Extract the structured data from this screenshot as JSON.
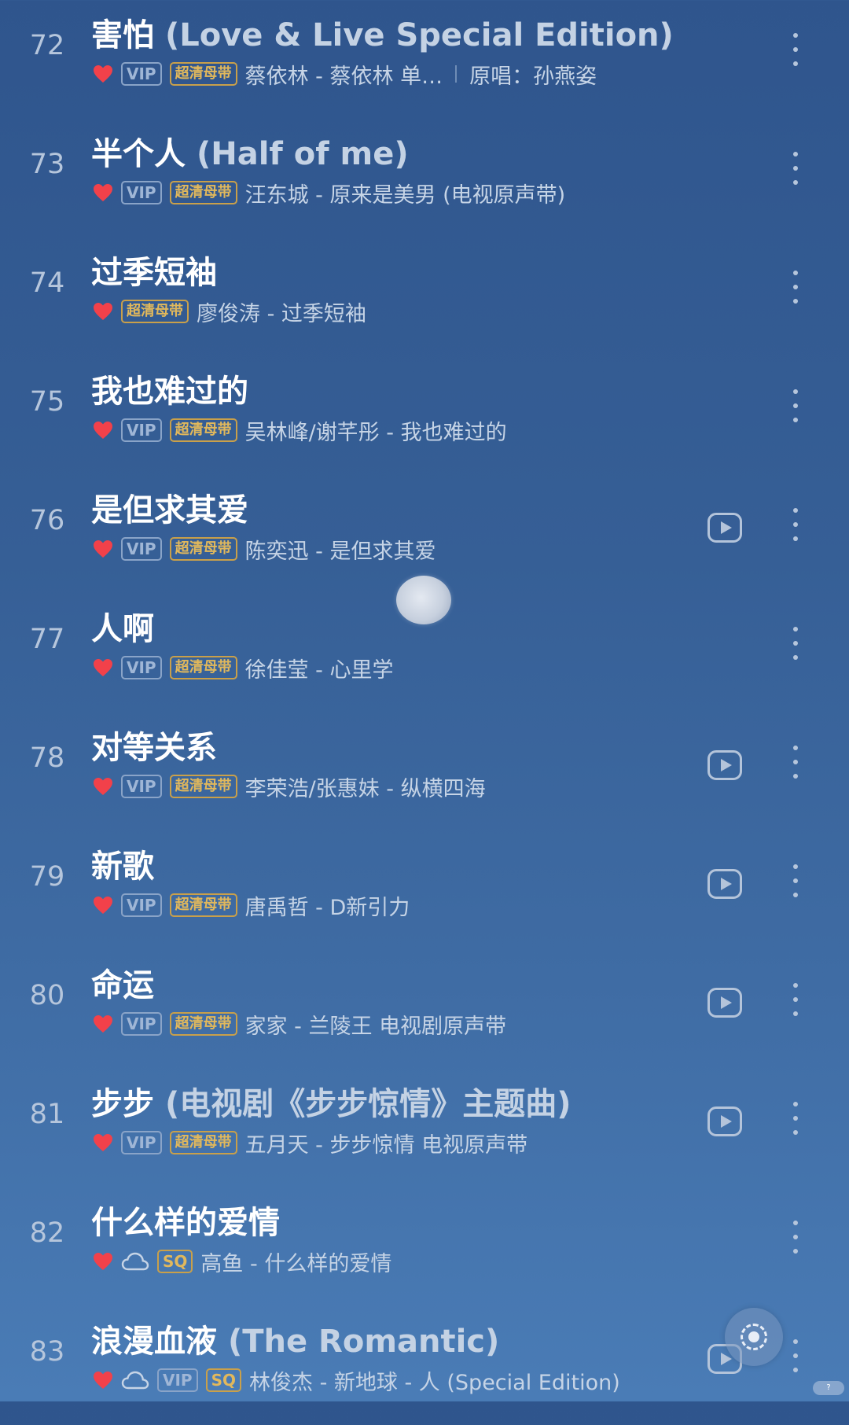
{
  "songs": [
    {
      "num": "72",
      "title": "害怕",
      "subtitle": "(Love & Live Special Edition)",
      "vip": "VIP",
      "quality": "超清母带",
      "info": "蔡依林 - 蔡依林 单…",
      "extra": "原唱：孙燕姿",
      "play": false
    },
    {
      "num": "73",
      "title": "半个人",
      "subtitle": "(Half of me)",
      "vip": "VIP",
      "quality": "超清母带",
      "info": "汪东城 - 原来是美男 (电视原声带)",
      "play": false
    },
    {
      "num": "74",
      "title": "过季短袖",
      "subtitle": "",
      "quality": "超清母带",
      "info": "廖俊涛 - 过季短袖",
      "play": false
    },
    {
      "num": "75",
      "title": "我也难过的",
      "subtitle": "",
      "vip": "VIP",
      "quality": "超清母带",
      "info": "吴林峰/谢芊彤 - 我也难过的",
      "play": false
    },
    {
      "num": "76",
      "title": "是但求其爱",
      "subtitle": "",
      "vip": "VIP",
      "quality": "超清母带",
      "info": "陈奕迅 - 是但求其爱",
      "play": true
    },
    {
      "num": "77",
      "title": "人啊",
      "subtitle": "",
      "vip": "VIP",
      "quality": "超清母带",
      "info": "徐佳莹 - 心里学",
      "play": false
    },
    {
      "num": "78",
      "title": "对等关系",
      "subtitle": "",
      "vip": "VIP",
      "quality": "超清母带",
      "info": "李荣浩/张惠妹 - 纵横四海",
      "play": true
    },
    {
      "num": "79",
      "title": "新歌",
      "subtitle": "",
      "vip": "VIP",
      "quality": "超清母带",
      "info": "唐禹哲 - D新引力",
      "play": true
    },
    {
      "num": "80",
      "title": "命运",
      "subtitle": "",
      "vip": "VIP",
      "quality": "超清母带",
      "info": "家家 - 兰陵王 电视剧原声带",
      "play": true
    },
    {
      "num": "81",
      "title": "步步",
      "subtitle": "(电视剧《步步惊情》主题曲)",
      "vip": "VIP",
      "quality": "超清母带",
      "info": "五月天 - 步步惊情 电视原声带",
      "play": true
    },
    {
      "num": "82",
      "title": "什么样的爱情",
      "subtitle": "",
      "cloud": true,
      "sq": "SQ",
      "info": "高鱼 - 什么样的爱情",
      "play": false
    },
    {
      "num": "83",
      "title": "浪漫血液",
      "subtitle": "(The Romantic)",
      "cloud": true,
      "vip": "VIP",
      "sq": "SQ",
      "info": "林俊杰 - 新地球 - 人 (Special Edition)",
      "play": true
    }
  ],
  "icons": {
    "liked": "heart-icon",
    "cloud": "cloud-icon",
    "play": "video-play-icon",
    "more": "more-vertical-icon",
    "fab": "now-playing-icon"
  },
  "colors": {
    "heart": "#f2414a",
    "badge_gold": "#e1b85c",
    "badge_vip": "#9fb6d6"
  },
  "status_pill": "?"
}
